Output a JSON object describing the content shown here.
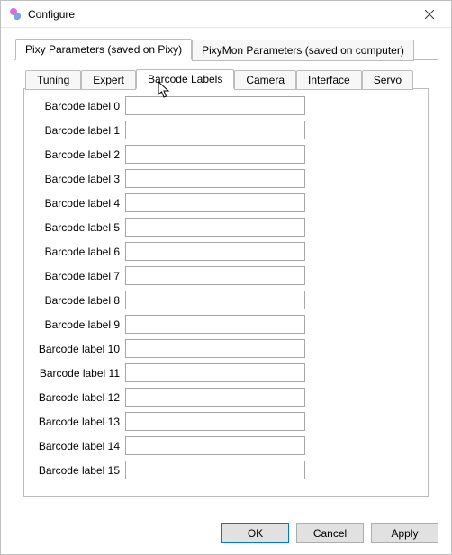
{
  "window": {
    "title": "Configure",
    "icon_colors": {
      "top": "#d86fcf",
      "bottom": "#7fa3e0"
    }
  },
  "outer_tabs": {
    "items": [
      {
        "label": "Pixy Parameters (saved on Pixy)",
        "active": true
      },
      {
        "label": "PixyMon Parameters (saved on computer)",
        "active": false
      }
    ]
  },
  "inner_tabs": {
    "items": [
      {
        "label": "Tuning",
        "active": false
      },
      {
        "label": "Expert",
        "active": false
      },
      {
        "label": "Barcode Labels",
        "active": true
      },
      {
        "label": "Camera",
        "active": false
      },
      {
        "label": "Interface",
        "active": false
      },
      {
        "label": "Servo",
        "active": false
      }
    ]
  },
  "fields": [
    {
      "label": "Barcode label 0",
      "value": ""
    },
    {
      "label": "Barcode label 1",
      "value": ""
    },
    {
      "label": "Barcode label 2",
      "value": ""
    },
    {
      "label": "Barcode label 3",
      "value": ""
    },
    {
      "label": "Barcode label 4",
      "value": ""
    },
    {
      "label": "Barcode label 5",
      "value": ""
    },
    {
      "label": "Barcode label 6",
      "value": ""
    },
    {
      "label": "Barcode label 7",
      "value": ""
    },
    {
      "label": "Barcode label 8",
      "value": ""
    },
    {
      "label": "Barcode label 9",
      "value": ""
    },
    {
      "label": "Barcode label 10",
      "value": ""
    },
    {
      "label": "Barcode label 11",
      "value": ""
    },
    {
      "label": "Barcode label 12",
      "value": ""
    },
    {
      "label": "Barcode label 13",
      "value": ""
    },
    {
      "label": "Barcode label 14",
      "value": ""
    },
    {
      "label": "Barcode label 15",
      "value": ""
    }
  ],
  "buttons": {
    "ok": "OK",
    "cancel": "Cancel",
    "apply": "Apply"
  }
}
